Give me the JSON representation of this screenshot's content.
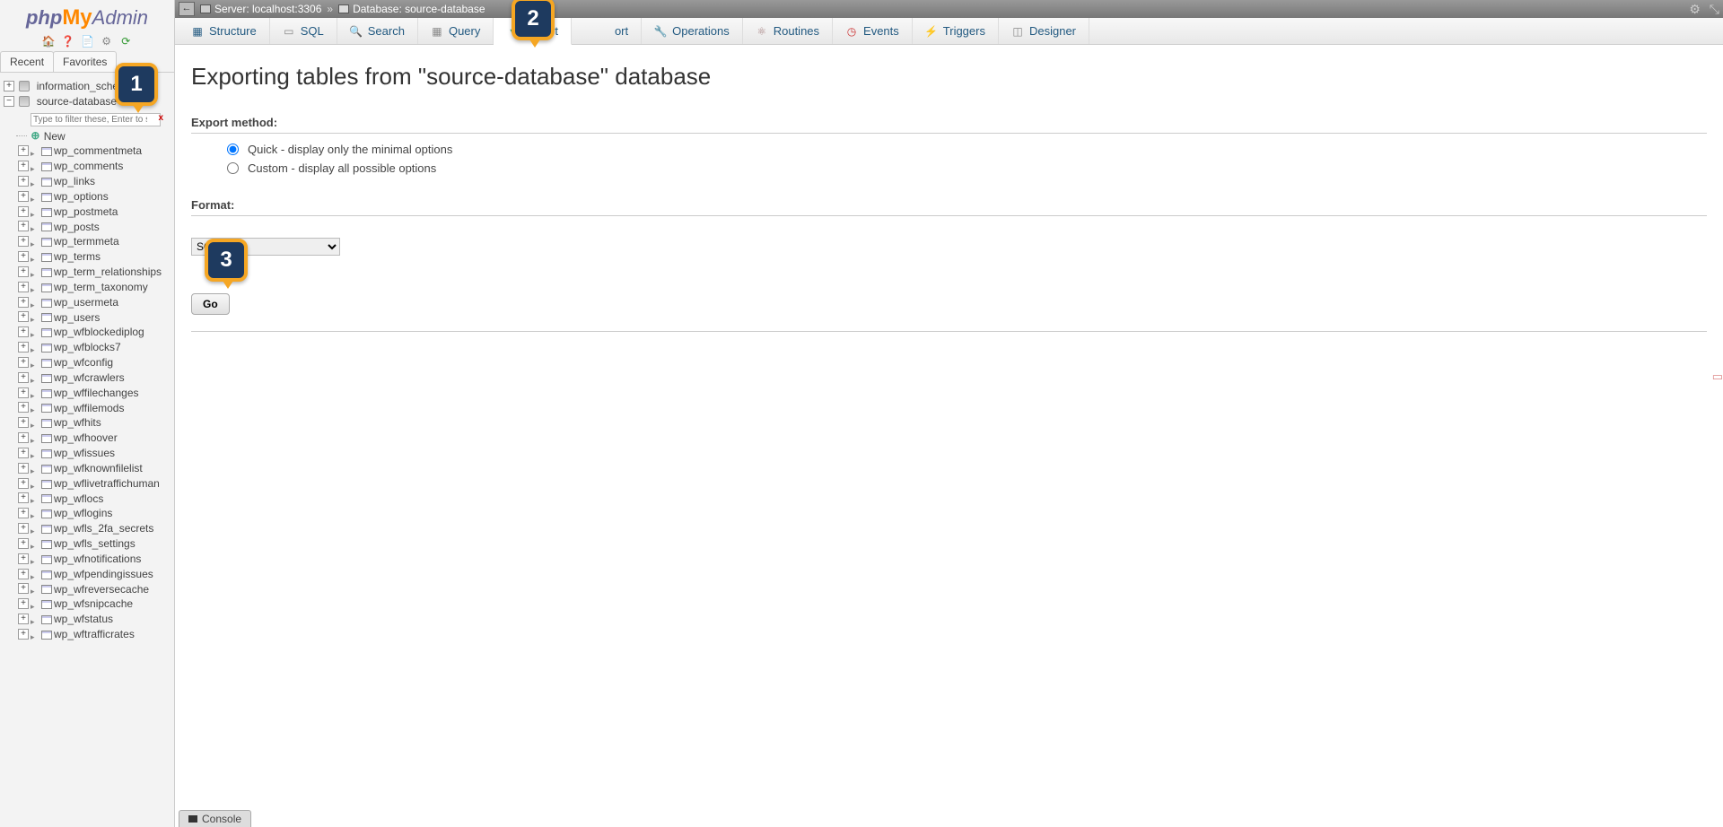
{
  "logo": {
    "php": "php",
    "my": "My",
    "admin": "Admin"
  },
  "sidebar": {
    "icons": [
      "home",
      "help",
      "docs",
      "settings",
      "reload"
    ],
    "tabs": {
      "recent": "Recent",
      "favorites": "Favorites"
    },
    "filter_placeholder": "Type to filter these, Enter to search a",
    "db1": "information_schema",
    "db2": "source-database",
    "new_label": "New",
    "tables": [
      "wp_commentmeta",
      "wp_comments",
      "wp_links",
      "wp_options",
      "wp_postmeta",
      "wp_posts",
      "wp_termmeta",
      "wp_terms",
      "wp_term_relationships",
      "wp_term_taxonomy",
      "wp_usermeta",
      "wp_users",
      "wp_wfblockediplog",
      "wp_wfblocks7",
      "wp_wfconfig",
      "wp_wfcrawlers",
      "wp_wffilechanges",
      "wp_wffilemods",
      "wp_wfhits",
      "wp_wfhoover",
      "wp_wfissues",
      "wp_wfknownfilelist",
      "wp_wflivetraffichuman",
      "wp_wflocs",
      "wp_wflogins",
      "wp_wfls_2fa_secrets",
      "wp_wfls_settings",
      "wp_wfnotifications",
      "wp_wfpendingissues",
      "wp_wfreversecache",
      "wp_wfsnipcache",
      "wp_wfstatus",
      "wp_wftrafficrates"
    ]
  },
  "topbar": {
    "server_label": "Server: localhost:3306",
    "db_label": "Database: source-database",
    "separator": "»"
  },
  "tabs": {
    "structure": "Structure",
    "sql": "SQL",
    "search": "Search",
    "query": "Query",
    "export": "Export",
    "import_visible": "ort",
    "operations": "Operations",
    "routines": "Routines",
    "events": "Events",
    "triggers": "Triggers",
    "designer": "Designer"
  },
  "page": {
    "title": "Exporting tables from \"source-database\" database",
    "method_label": "Export method:",
    "radio_quick": "Quick - display only the minimal options",
    "radio_custom": "Custom - display all possible options",
    "format_label": "Format:",
    "format_value": "SQL",
    "go": "Go"
  },
  "console": {
    "label": "Console"
  },
  "callouts": {
    "c1": "1",
    "c2": "2",
    "c3": "3"
  }
}
